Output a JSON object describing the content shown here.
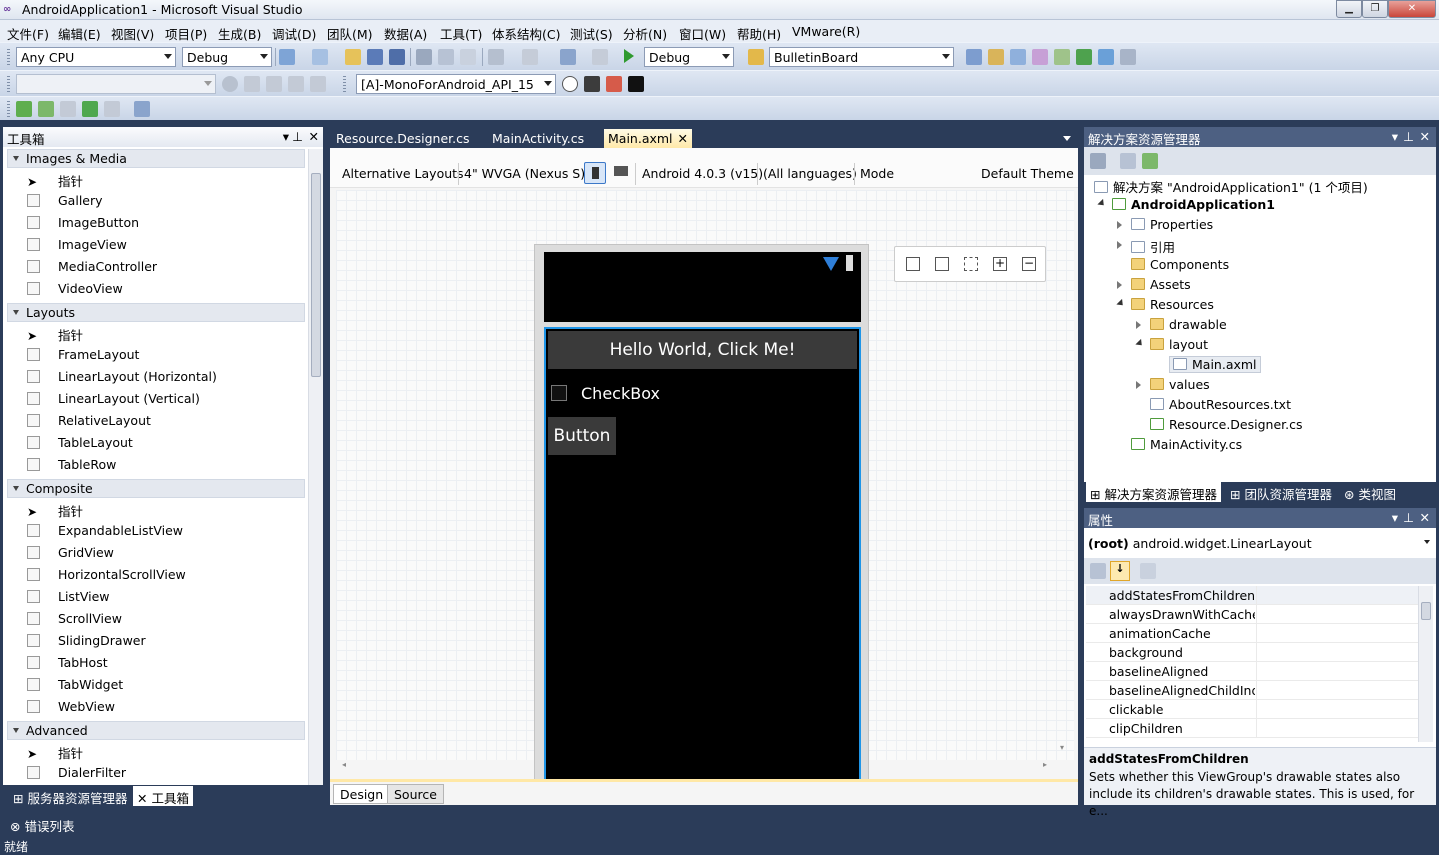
{
  "window": {
    "title": "AndroidApplication1 - Microsoft Visual Studio"
  },
  "menu": [
    "文件(F)",
    "编辑(E)",
    "视图(V)",
    "项目(P)",
    "生成(B)",
    "调试(D)",
    "团队(M)",
    "数据(A)",
    "工具(T)",
    "体系结构(C)",
    "测试(S)",
    "分析(N)",
    "窗口(W)",
    "帮助(H)",
    "VMware(R)"
  ],
  "toolbar": {
    "platform": "Any CPU",
    "config": "Debug",
    "run_config": "Debug",
    "find": "BulletinBoard",
    "api_target": "[A]-MonoForAndroid_API_15"
  },
  "toolbox": {
    "title": "工具箱",
    "categories": [
      {
        "name": "Images & Media",
        "items": [
          "指针",
          "Gallery",
          "ImageButton",
          "ImageView",
          "MediaController",
          "VideoView"
        ]
      },
      {
        "name": "Layouts",
        "items": [
          "指针",
          "FrameLayout",
          "LinearLayout (Horizontal)",
          "LinearLayout (Vertical)",
          "RelativeLayout",
          "TableLayout",
          "TableRow"
        ]
      },
      {
        "name": "Composite",
        "items": [
          "指针",
          "ExpandableListView",
          "GridView",
          "HorizontalScrollView",
          "ListView",
          "ScrollView",
          "SlidingDrawer",
          "TabHost",
          "TabWidget",
          "WebView"
        ]
      },
      {
        "name": "Advanced",
        "items": [
          "指针",
          "DialerFilter"
        ]
      }
    ],
    "bottom_tabs": [
      "服务器资源管理器",
      "工具箱"
    ],
    "error_list": "错误列表"
  },
  "tabs": [
    "Resource.Designer.cs",
    "MainActivity.cs",
    "Main.axml"
  ],
  "designer": {
    "alt_layouts": "Alternative Layouts",
    "device": "4\" WVGA (Nexus S)",
    "api": "Android 4.0.3 (v15)",
    "languages": "(All languages)",
    "mode": "Mode",
    "theme": "Default Theme",
    "hello_button": "Hello World, Click Me!",
    "checkbox": "CheckBox",
    "button": "Button",
    "view_tabs": [
      "Design",
      "Source"
    ]
  },
  "solution": {
    "title": "解决方案资源管理器",
    "nodes": [
      "解决方案 \"AndroidApplication1\" (1 个项目)",
      "AndroidApplication1",
      "Properties",
      "引用",
      "Components",
      "Assets",
      "Resources",
      "drawable",
      "layout",
      "Main.axml",
      "values",
      "AboutResources.txt",
      "Resource.Designer.cs",
      "MainActivity.cs"
    ],
    "bottom_tabs": [
      "解决方案资源管理器",
      "团队资源管理器",
      "类视图"
    ]
  },
  "properties": {
    "title": "属性",
    "object_prefix": "(root)",
    "object": "android.widget.LinearLayout",
    "rows": [
      "addStatesFromChildren",
      "alwaysDrawnWithCache",
      "animationCache",
      "background",
      "baselineAligned",
      "baselineAlignedChildInde",
      "clickable",
      "clipChildren"
    ],
    "desc_title": "addStatesFromChildren",
    "desc_text": "Sets whether this ViewGroup's drawable states also include its children's drawable states. This is used, for e..."
  },
  "status": "就绪"
}
